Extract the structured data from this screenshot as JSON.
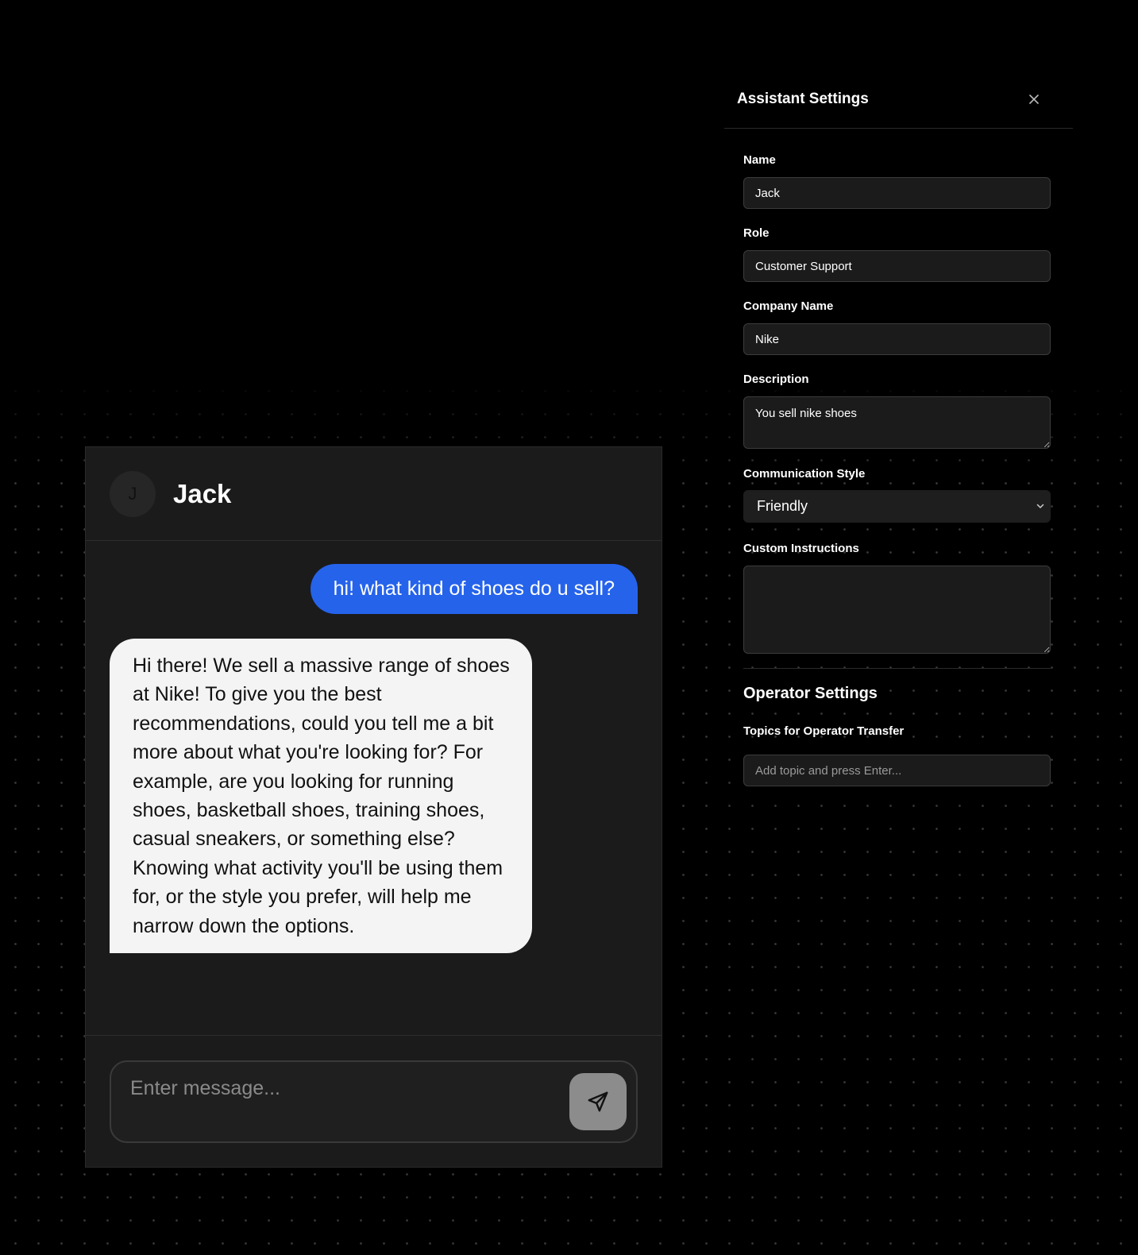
{
  "chat": {
    "avatar_initial": "J",
    "title": "Jack",
    "messages": [
      {
        "from": "user",
        "text": "hi! what kind of shoes do u sell?"
      },
      {
        "from": "assistant",
        "text": "Hi there! We sell a massive range of shoes at Nike! To give you the best recommendations, could you tell me a bit more about what you're looking for? For example, are you looking for running shoes, basketball shoes, training shoes, casual sneakers, or something else? Knowing what activity you'll be using them for, or the style you prefer, will help me narrow down the options."
      }
    ],
    "composer": {
      "placeholder": "Enter message...",
      "value": "",
      "send_icon": "send-icon"
    },
    "colors": {
      "user_bubble": "#2563eb",
      "assistant_bubble": "#f4f4f4"
    }
  },
  "settings": {
    "title": "Assistant Settings",
    "close_icon": "close-icon",
    "fields": {
      "name": {
        "label": "Name",
        "value": "Jack"
      },
      "role": {
        "label": "Role",
        "value": "Customer Support"
      },
      "company": {
        "label": "Company Name",
        "value": "Nike"
      },
      "description": {
        "label": "Description",
        "value": "You sell nike shoes"
      },
      "style": {
        "label": "Communication Style",
        "value": "Friendly"
      },
      "custom": {
        "label": "Custom Instructions",
        "value": ""
      }
    },
    "operator": {
      "title": "Operator Settings",
      "topics_label": "Topics for Operator Transfer",
      "topics_placeholder": "Add topic and press Enter..."
    }
  }
}
